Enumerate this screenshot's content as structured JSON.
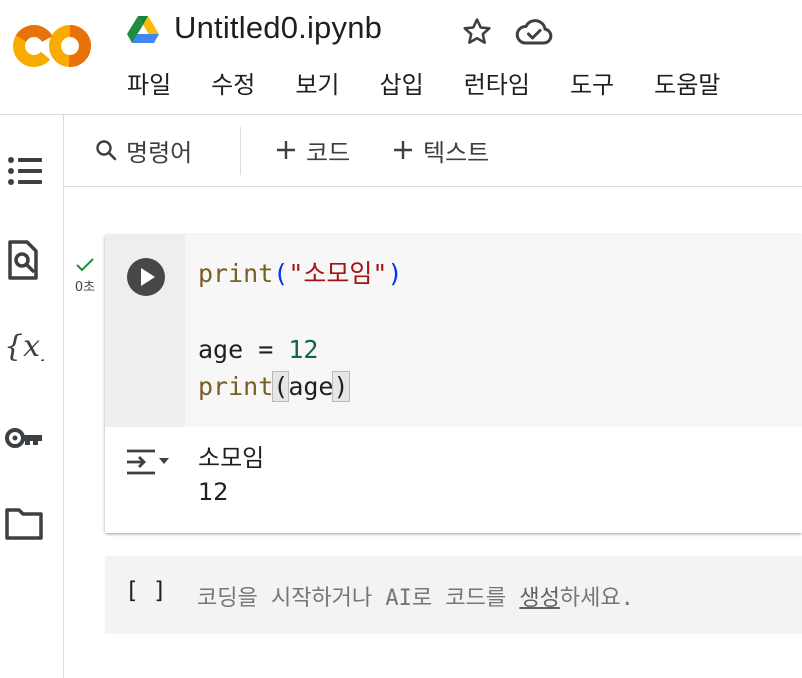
{
  "app": {
    "logo": "colab-logo",
    "doc_title": "Untitled0.ipynb"
  },
  "menu": [
    "파일",
    "수정",
    "보기",
    "삽입",
    "런타임",
    "도구",
    "도움말"
  ],
  "toolbar": {
    "search_label": "명령어",
    "add_code_label": "코드",
    "add_text_label": "텍스트"
  },
  "sidebar": {
    "icons": [
      "table-of-contents-icon",
      "find-icon",
      "variables-icon",
      "secrets-key-icon",
      "files-folder-icon"
    ]
  },
  "code_cell": {
    "exec_time": "0초",
    "status": "success",
    "code": {
      "line1": {
        "fn": "print",
        "open": "(",
        "str": "\"소모임\"",
        "close": ")"
      },
      "line3": {
        "var": "age",
        "op": " = ",
        "num": "12"
      },
      "line4": {
        "fn": "print",
        "open": "(",
        "var": "age",
        "close": ")"
      }
    },
    "output": [
      "소모임",
      "12"
    ]
  },
  "empty_cell": {
    "brackets": "[ ]",
    "placeholder_pre": "코딩을 시작하거나 AI로 코드를 ",
    "placeholder_link": "생성",
    "placeholder_post": "하세요."
  },
  "colors": {
    "accent_orange": "#e8710a",
    "accent_yellow": "#f9ab00",
    "success_green": "#1e8e3e"
  }
}
